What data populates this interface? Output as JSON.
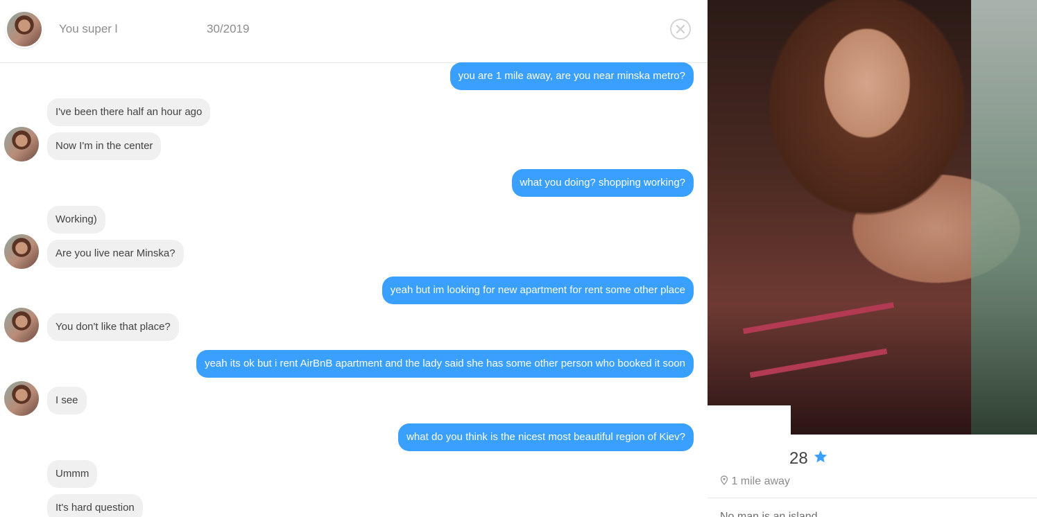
{
  "header": {
    "title": "You super l",
    "date": "30/2019"
  },
  "messages": [
    {
      "side": "out",
      "text": "you are 1 mile away, are you near minska metro?"
    },
    {
      "side": "in",
      "text": "I've been there half an hour ago"
    },
    {
      "side": "in",
      "text": "Now I'm in the center"
    },
    {
      "side": "out",
      "text": "what you doing? shopping working?"
    },
    {
      "side": "in",
      "text": "Working)"
    },
    {
      "side": "in",
      "text": "Are you live near Minska?"
    },
    {
      "side": "out",
      "text": "yeah but im looking for new apartment for rent some other place"
    },
    {
      "side": "in",
      "text": "You don't like that place?"
    },
    {
      "side": "out",
      "text": "yeah its ok but i rent AirBnB apartment and the lady said she has some other person who booked it soon"
    },
    {
      "side": "in",
      "text": "I see"
    },
    {
      "side": "out",
      "text": "what do you think is the nicest most beautiful region of Kiev?"
    },
    {
      "side": "in",
      "text": "Ummm"
    },
    {
      "side": "in",
      "text": "It's hard question"
    }
  ],
  "profile": {
    "age": "28",
    "distance": "1 mile away",
    "bio": "No man is an island"
  },
  "colors": {
    "outgoing_bubble": "#3aa0ff",
    "incoming_bubble": "#f0f0f0",
    "verified_star": "#3aa0ff"
  },
  "icons": {
    "close": "close-icon",
    "verified": "verified-star-icon",
    "location": "location-pin-icon"
  }
}
